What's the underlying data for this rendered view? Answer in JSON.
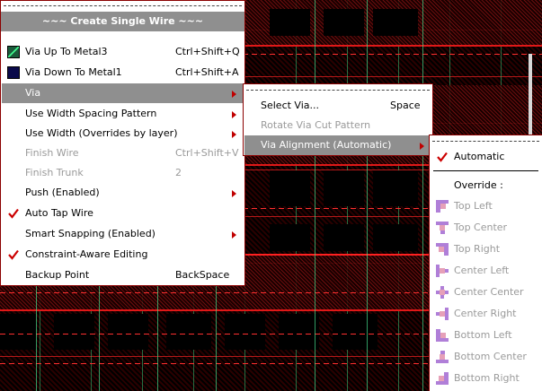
{
  "main_menu": {
    "title": "~~~ Create Single Wire ~~~",
    "items": [
      {
        "label": "Via Up To Metal3",
        "accel": "Ctrl+Shift+Q"
      },
      {
        "label": "Via Down To Metal1",
        "accel": "Ctrl+Shift+A"
      },
      {
        "label": "Via"
      },
      {
        "label": "Use Width Spacing Pattern"
      },
      {
        "label": "Use Width (Overrides by layer)"
      },
      {
        "label": "Finish Wire",
        "accel": "Ctrl+Shift+V"
      },
      {
        "label": "Finish Trunk",
        "accel": "2"
      },
      {
        "label": "Push (Enabled)"
      },
      {
        "label": "Auto Tap Wire"
      },
      {
        "label": "Smart Snapping (Enabled)"
      },
      {
        "label": "Constraint-Aware Editing"
      },
      {
        "label": "Backup Point",
        "accel": "BackSpace"
      }
    ]
  },
  "via_submenu": {
    "items": [
      {
        "label": "Select Via...",
        "accel": "Space"
      },
      {
        "label": "Rotate Via Cut Pattern"
      },
      {
        "label": "Via Alignment (Automatic)"
      }
    ]
  },
  "alignment_submenu": {
    "automatic": "Automatic",
    "override_header": "Override :",
    "items": [
      {
        "label": "Top Left"
      },
      {
        "label": "Top Center"
      },
      {
        "label": "Top Right"
      },
      {
        "label": "Center Left"
      },
      {
        "label": "Center Center"
      },
      {
        "label": "Center Right"
      },
      {
        "label": "Bottom Left"
      },
      {
        "label": "Bottom Center"
      },
      {
        "label": "Bottom Right"
      }
    ]
  },
  "colors": {
    "highlight": "#8f8f8f",
    "check": "#cc0000",
    "icon_purple": "#b07fd8",
    "icon_pink": "#e6a0b8",
    "metal3_swatch": "#1a5a3a",
    "metal1_swatch": "#0a0a4a"
  }
}
